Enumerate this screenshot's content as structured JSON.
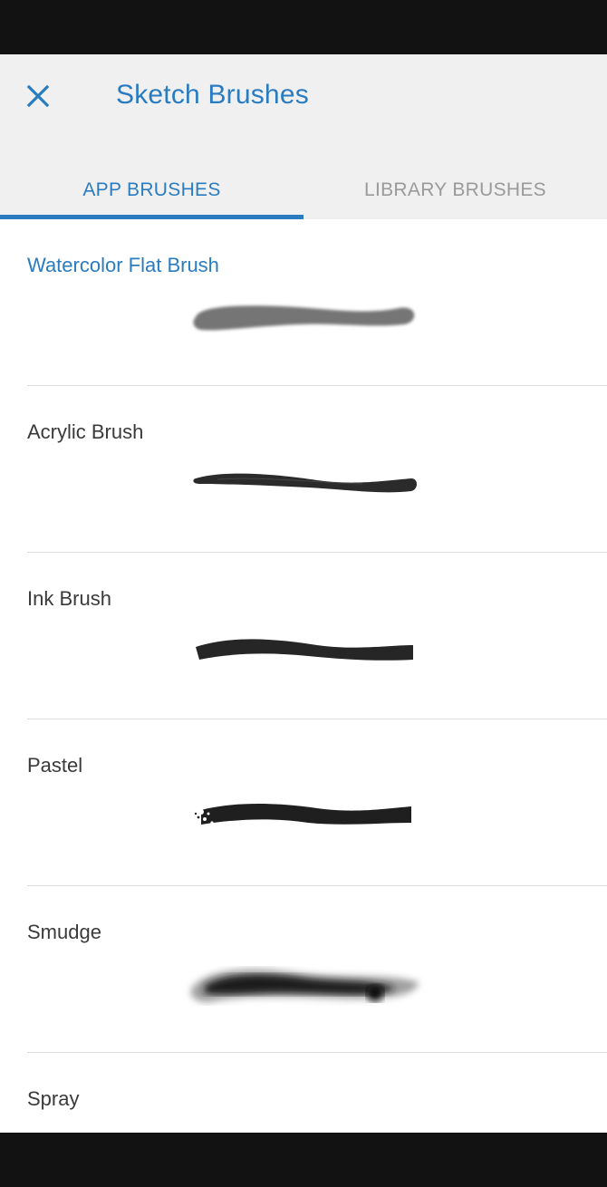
{
  "header": {
    "title": "Sketch Brushes",
    "close_icon": "close-icon",
    "accent_color": "#2a7cc1"
  },
  "tabs": [
    {
      "label": "APP BRUSHES",
      "active": true
    },
    {
      "label": "LIBRARY BRUSHES",
      "active": false
    }
  ],
  "brushes": [
    {
      "name": "Watercolor Flat Brush",
      "selected": true,
      "preview": "watercolor-stroke"
    },
    {
      "name": "Acrylic Brush",
      "selected": false,
      "preview": "acrylic-stroke"
    },
    {
      "name": "Ink Brush",
      "selected": false,
      "preview": "ink-stroke"
    },
    {
      "name": "Pastel",
      "selected": false,
      "preview": "pastel-stroke"
    },
    {
      "name": "Smudge",
      "selected": false,
      "preview": "smudge-stroke"
    },
    {
      "name": "Spray",
      "selected": false,
      "preview": "spray-stroke"
    }
  ]
}
